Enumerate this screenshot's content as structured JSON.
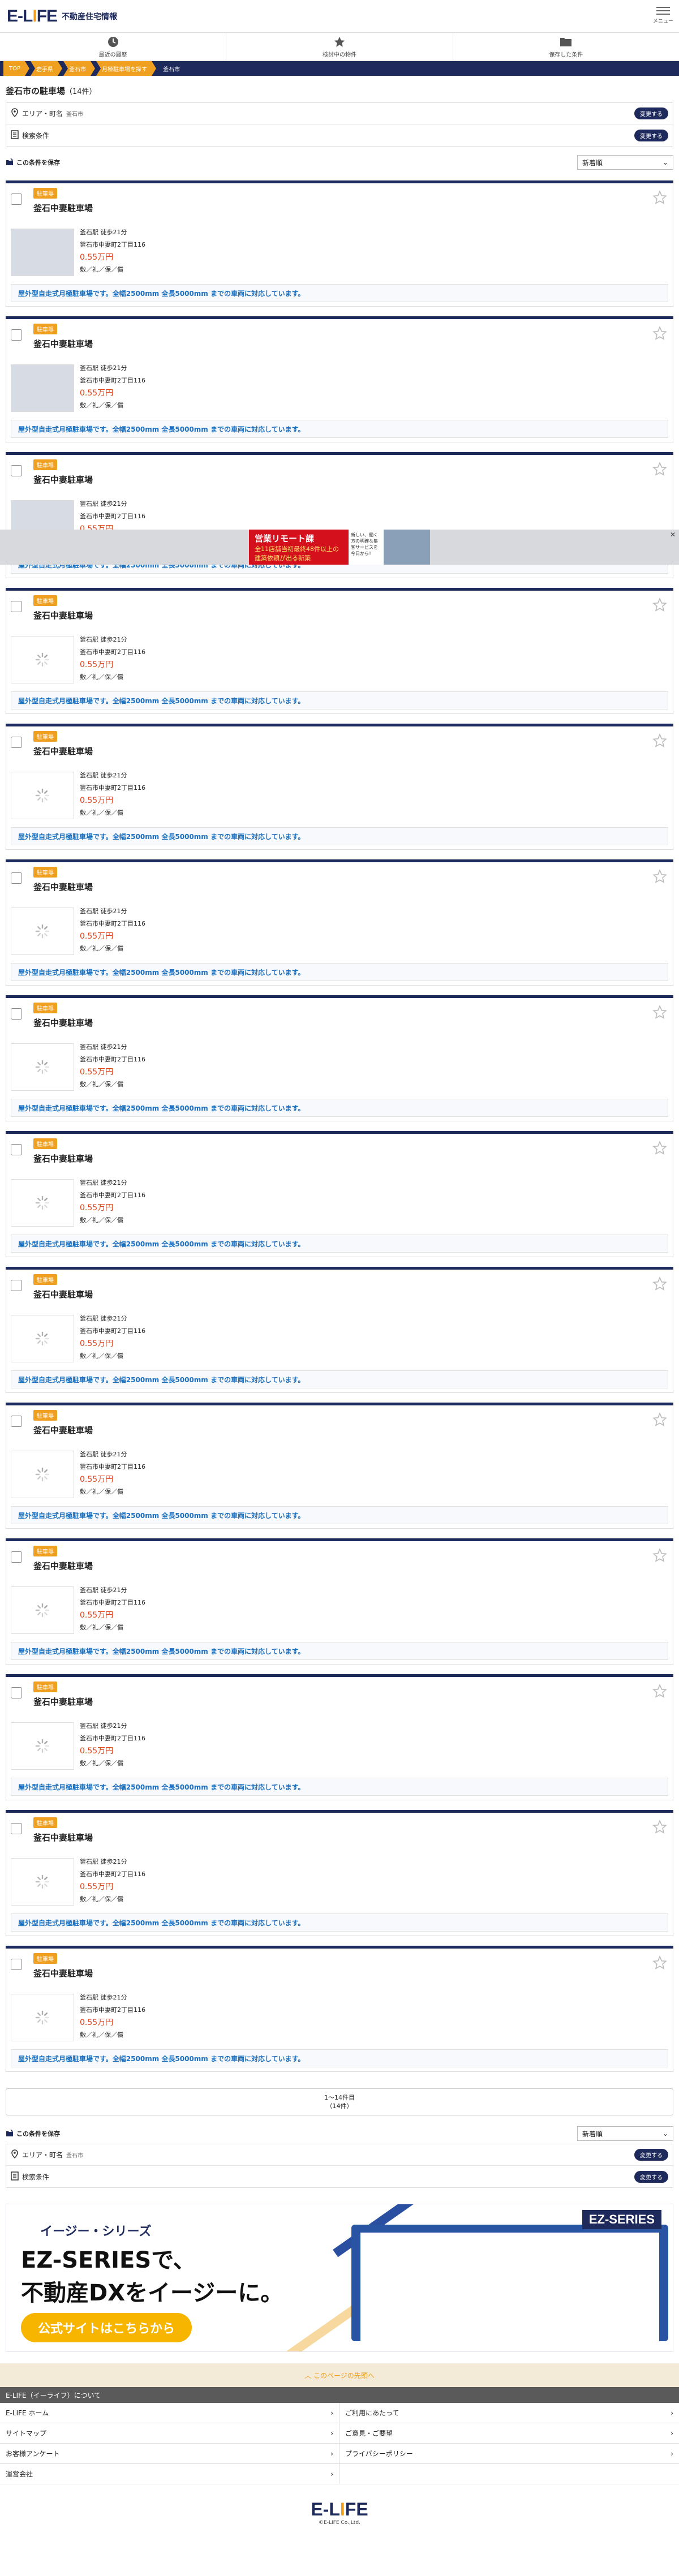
{
  "header": {
    "logo_a": "E",
    "logo_b": "L",
    "logo_c": "FE",
    "logo_sub": "不動産住宅情報",
    "menu_label": "メニュー"
  },
  "tabs": [
    "最近の履歴",
    "検討中の物件",
    "保存した条件"
  ],
  "breadcrumbs": [
    "TOP",
    "岩手県",
    "釜石市",
    "月極駐車場を探す",
    "釜石市"
  ],
  "page": {
    "title": "釜石市の駐車場",
    "count": "（14件）"
  },
  "conditions": {
    "area_label": "エリア・町名",
    "area_value": "釜石市",
    "search_label": "検索条件",
    "change_label": "変更する"
  },
  "save_label": "この条件を保存",
  "sort": {
    "selected": "新着順"
  },
  "listing": {
    "tag": "駐車場",
    "name": "釜石中妻駐車場",
    "station": "釜石駅 徒歩21分",
    "address": "釜石市中妻町2丁目116",
    "price": "0.55万円",
    "misc": "敷／礼／保／償",
    "desc": "屋外型自走式月極駐車場です。全幅2500mm 全長5000mm までの車両に対応しています。"
  },
  "listing_count": 14,
  "ad": {
    "title": "営業リモート課",
    "line2": "全11店舗当初最終48件以上の",
    "line3": "建築依頼が出る新築",
    "side": "新しい、働く方の明確な集客サービスを今日から！"
  },
  "pager": {
    "range": "1〜14件目",
    "total": "（14件）"
  },
  "banner": {
    "sub": "イージー・シリーズ",
    "main1": "EZ-SERIESで、",
    "main2": "不動産DXをイージーに。",
    "cta": "公式サイトはこちらから",
    "badge": "EZ-SERIES"
  },
  "pagetop": "このページの先頭へ",
  "about": "E-LIFE（イーライフ）について",
  "footer_links": [
    "E-LIFE ホーム",
    "ご利用にあたって",
    "サイトマップ",
    "ご意見・ご要望",
    "お客様アンケート",
    "プライバシーポリシー",
    "運営会社",
    ""
  ],
  "copyright": "©E-LIFE Co.,Ltd."
}
